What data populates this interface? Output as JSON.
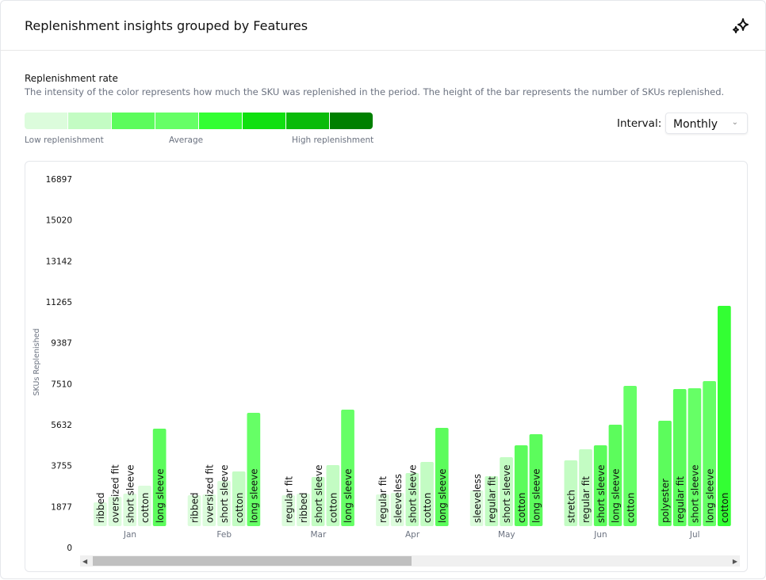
{
  "header": {
    "title": "Replenishment insights grouped by Features",
    "icon": "sparkles-icon"
  },
  "rate": {
    "label": "Replenishment rate",
    "description": "The intensity of the color represents how much the SKU was replenished in the period. The height of the bar represents the number of SKUs replenished.",
    "scale_colors": [
      "#dcfcdc",
      "#c3fcc3",
      "#5cfc5c",
      "#66ff66",
      "#33ff33",
      "#10e010",
      "#0abb0a",
      "#008000"
    ],
    "low": "Low replenishment",
    "avg": "Average",
    "high": "High replenishment"
  },
  "interval": {
    "label": "Interval:",
    "value": "Monthly"
  },
  "chart_data": {
    "type": "bar",
    "ylabel": "SKUs Replenished",
    "ylim": [
      0,
      16897
    ],
    "yticks": [
      "0",
      "1877",
      "3755",
      "5632",
      "7510",
      "9387",
      "11265",
      "13142",
      "15020",
      "16897"
    ],
    "groups": [
      {
        "month": "Jan",
        "bars": [
          {
            "feature": "ribbed",
            "value": 2071,
            "level": 0
          },
          {
            "feature": "oversized fit",
            "value": 2326,
            "level": 0
          },
          {
            "feature": "short sleeve",
            "value": 2471,
            "level": 0
          },
          {
            "feature": "cotton",
            "value": 2835,
            "level": 0
          },
          {
            "feature": "long sleeve",
            "value": 5451,
            "level": 2
          }
        ]
      },
      {
        "month": "Feb",
        "bars": [
          {
            "feature": "ribbed",
            "value": 2398,
            "level": 0
          },
          {
            "feature": "oversized fit",
            "value": 2435,
            "level": 0
          },
          {
            "feature": "short sleeve",
            "value": 3053,
            "level": 0
          },
          {
            "feature": "cotton",
            "value": 3489,
            "level": 1
          },
          {
            "feature": "long sleeve",
            "value": 6178,
            "level": 3
          }
        ]
      },
      {
        "month": "Mar",
        "bars": [
          {
            "feature": "regular fit",
            "value": 2398,
            "level": 0
          },
          {
            "feature": "ribbed",
            "value": 2471,
            "level": 0
          },
          {
            "feature": "short sleeve",
            "value": 3234,
            "level": 1
          },
          {
            "feature": "cotton",
            "value": 3779,
            "level": 1
          },
          {
            "feature": "long sleeve",
            "value": 6323,
            "level": 3
          }
        ]
      },
      {
        "month": "Apr",
        "bars": [
          {
            "feature": "regular fit",
            "value": 2435,
            "level": 0
          },
          {
            "feature": "sleeveless",
            "value": 2507,
            "level": 0
          },
          {
            "feature": "short sleeve",
            "value": 3416,
            "level": 1
          },
          {
            "feature": "cotton",
            "value": 3925,
            "level": 1
          },
          {
            "feature": "long sleeve",
            "value": 5487,
            "level": 2
          }
        ]
      },
      {
        "month": "May",
        "bars": [
          {
            "feature": "sleeveless",
            "value": 2616,
            "level": 0
          },
          {
            "feature": "regular fit",
            "value": 3271,
            "level": 1
          },
          {
            "feature": "short sleeve",
            "value": 4143,
            "level": 1
          },
          {
            "feature": "cotton",
            "value": 4688,
            "level": 2
          },
          {
            "feature": "long sleeve",
            "value": 5197,
            "level": 2
          }
        ]
      },
      {
        "month": "Jun",
        "bars": [
          {
            "feature": "stretch",
            "value": 3997,
            "level": 1
          },
          {
            "feature": "regular fit",
            "value": 4506,
            "level": 1
          },
          {
            "feature": "short sleeve",
            "value": 4688,
            "level": 2
          },
          {
            "feature": "long sleeve",
            "value": 5633,
            "level": 2
          },
          {
            "feature": "cotton",
            "value": 7413,
            "level": 3
          }
        ]
      },
      {
        "month": "Jul",
        "bars": [
          {
            "feature": "polyester",
            "value": 5814,
            "level": 2
          },
          {
            "feature": "regular fit",
            "value": 7268,
            "level": 2
          },
          {
            "feature": "short sleeve",
            "value": 7304,
            "level": 3
          },
          {
            "feature": "long sleeve",
            "value": 7631,
            "level": 3
          },
          {
            "feature": "cotton",
            "value": 11084,
            "level": 4
          }
        ]
      }
    ]
  }
}
